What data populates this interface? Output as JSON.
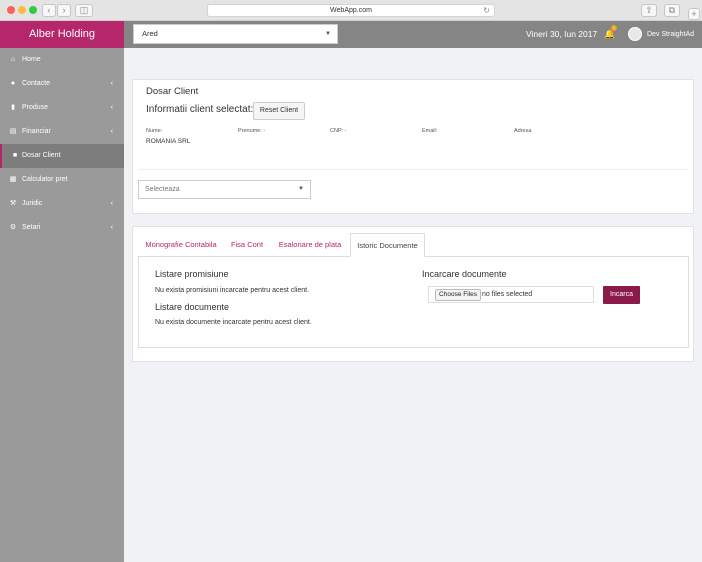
{
  "browser": {
    "url": "WebApp.com"
  },
  "header": {
    "brand": "Alber Holding",
    "company_select": "Ared",
    "date": "Vineri 30, Iun 2017",
    "notification_count": "1",
    "user_name": "Dev StraightAd"
  },
  "sidebar": {
    "items": [
      {
        "label": "Home",
        "icon": "home-icon"
      },
      {
        "label": "Contacte",
        "icon": "user-icon"
      },
      {
        "label": "Produse",
        "icon": "book-icon"
      },
      {
        "label": "Financiar",
        "icon": "money-icon"
      },
      {
        "label": "Dosar Client",
        "icon": "folder-icon"
      },
      {
        "label": "Calculator pret",
        "icon": "calculator-icon"
      },
      {
        "label": "Juridic",
        "icon": "gavel-icon"
      },
      {
        "label": "Setari",
        "icon": "gears-icon"
      }
    ]
  },
  "client_card": {
    "title": "Dosar Client",
    "subtitle": "Informatii client selectat:",
    "reset_button": "Reset Client",
    "fields": [
      {
        "label": "Nume:",
        "value": "ROMANIA SRL"
      },
      {
        "label": "Prenume: -",
        "value": ""
      },
      {
        "label": "CNP: -",
        "value": ""
      },
      {
        "label": "Email:",
        "value": ""
      },
      {
        "label": "Adresa",
        "value": ""
      }
    ],
    "select_placeholder": "Selecteaza"
  },
  "documents_card": {
    "tabs": [
      {
        "label": "Monografie Contabila"
      },
      {
        "label": "Fisa Cont"
      },
      {
        "label": "Esalonare de plata"
      },
      {
        "label": "Istoric Documente"
      }
    ],
    "promisiuni_title": "Listare promisiune",
    "promisiuni_empty": "Nu exista promisiuni incarcate pentru acest client.",
    "documente_title": "Listare documente",
    "documente_empty": "Nu exista documente incarcate pentru acest client.",
    "upload_title": "Incarcare documente",
    "choose_files": "Choose Files",
    "no_files": "no files selected",
    "upload_button": "Incarca"
  },
  "colors": {
    "brand": "#b5266b",
    "upload_button": "#8b1a4a",
    "topbar": "#858585",
    "sidebar": "#9a9a9a"
  }
}
